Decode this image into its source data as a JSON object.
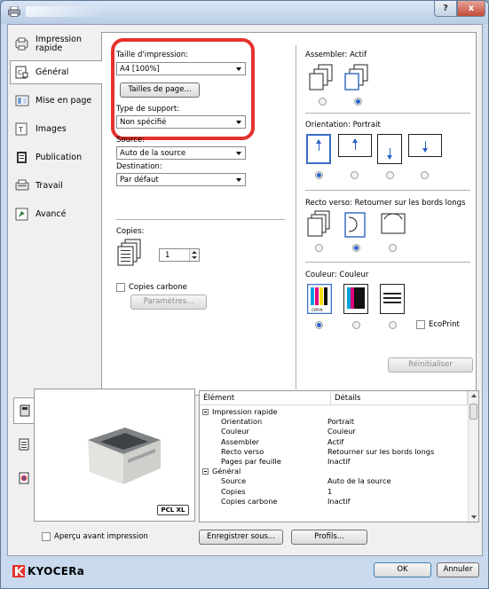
{
  "colors": {
    "accent": "#2a63c9",
    "highlight": "#e5322d",
    "brand": "#e5322d"
  },
  "titlebar": {
    "help_label": "?",
    "close_label": "x"
  },
  "nav": {
    "items": [
      {
        "label": "Impression rapide",
        "icon": "quick-print-icon"
      },
      {
        "label": "Général",
        "icon": "general-icon"
      },
      {
        "label": "Mise en page",
        "icon": "layout-icon"
      },
      {
        "label": "Images",
        "icon": "images-icon"
      },
      {
        "label": "Publication",
        "icon": "publishing-icon"
      },
      {
        "label": "Travail",
        "icon": "job-icon"
      },
      {
        "label": "Avancé",
        "icon": "advanced-icon"
      }
    ]
  },
  "main": {
    "print_size": {
      "label": "Taille d'impression:",
      "value": "A4 [100%]"
    },
    "page_sizes_button": "Tailles de page...",
    "media_type": {
      "label": "Type de support:",
      "value": "Non spécifié"
    },
    "source": {
      "label": "Source:",
      "value": "Auto de la source"
    },
    "destination": {
      "label": "Destination:",
      "value": "Par défaut"
    },
    "copies": {
      "label": "Copies:",
      "value": "1"
    },
    "carbon_copies": {
      "label": "Copies carbone"
    },
    "settings_button": "Paramètres..."
  },
  "right": {
    "collate": {
      "label": "Assembler:",
      "value": "Actif"
    },
    "orientation": {
      "label": "Orientation:",
      "value": "Portrait"
    },
    "duplex": {
      "label": "Recto verso:",
      "value": "Retourner sur les bords longs"
    },
    "color": {
      "label": "Couleur:",
      "value": "Couleur"
    },
    "ecoprint": {
      "label": "EcoPrint"
    },
    "reset_button": "Réinitialiser"
  },
  "preview": {
    "pcl_badge": "PCL XL"
  },
  "summary": {
    "col_element": "Élément",
    "col_details": "Détails",
    "rows": [
      {
        "element": "Impression rapide",
        "details": "",
        "group": true
      },
      {
        "element": "Orientation",
        "details": "Portrait"
      },
      {
        "element": "Couleur",
        "details": "Couleur"
      },
      {
        "element": "Assembler",
        "details": "Actif"
      },
      {
        "element": "Recto verso",
        "details": "Retourner sur les bords longs"
      },
      {
        "element": "Pages par feuille",
        "details": "Inactif"
      },
      {
        "element": "Général",
        "details": "",
        "group": true
      },
      {
        "element": "Source",
        "details": "Auto de la source"
      },
      {
        "element": "Copies",
        "details": "1"
      },
      {
        "element": "Copies carbone",
        "details": "Inactif"
      }
    ]
  },
  "footer": {
    "preview_checkbox": "Aperçu avant impression",
    "save_as_button": "Enregistrer sous...",
    "profiles_button": "Profils...",
    "brand": "KYOCERa",
    "ok_button": "OK",
    "cancel_button": "Annuler"
  }
}
